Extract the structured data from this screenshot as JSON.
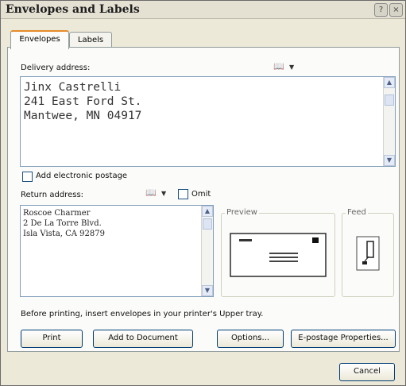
{
  "window": {
    "title": "Envelopes and Labels"
  },
  "tabs": [
    {
      "label": "Envelopes",
      "active": true
    },
    {
      "label": "Labels",
      "active": false
    }
  ],
  "delivery": {
    "label": "Delivery address:",
    "lines": "Jinx Castrelli\n241 East Ford St.\nMantwee, MN 04917"
  },
  "postage": {
    "label": "Add electronic postage",
    "checked": false
  },
  "return_address": {
    "label": "Return address:",
    "omit_label": "Omit",
    "omit_checked": false,
    "lines": "Roscoe Charmer\n2 De La Torre Blvd.\nIsla Vista, CA 92879"
  },
  "preview": {
    "label": "Preview"
  },
  "feed": {
    "label": "Feed"
  },
  "info": "Before printing, insert envelopes in your printer's Upper tray.",
  "buttons": {
    "print": "Print",
    "add_to_document": "Add to Document",
    "options": "Options...",
    "epostage": "E-postage Properties...",
    "cancel": "Cancel"
  },
  "icons": {
    "help": "help-icon",
    "close": "close-icon",
    "address_book": "address-book-icon"
  }
}
